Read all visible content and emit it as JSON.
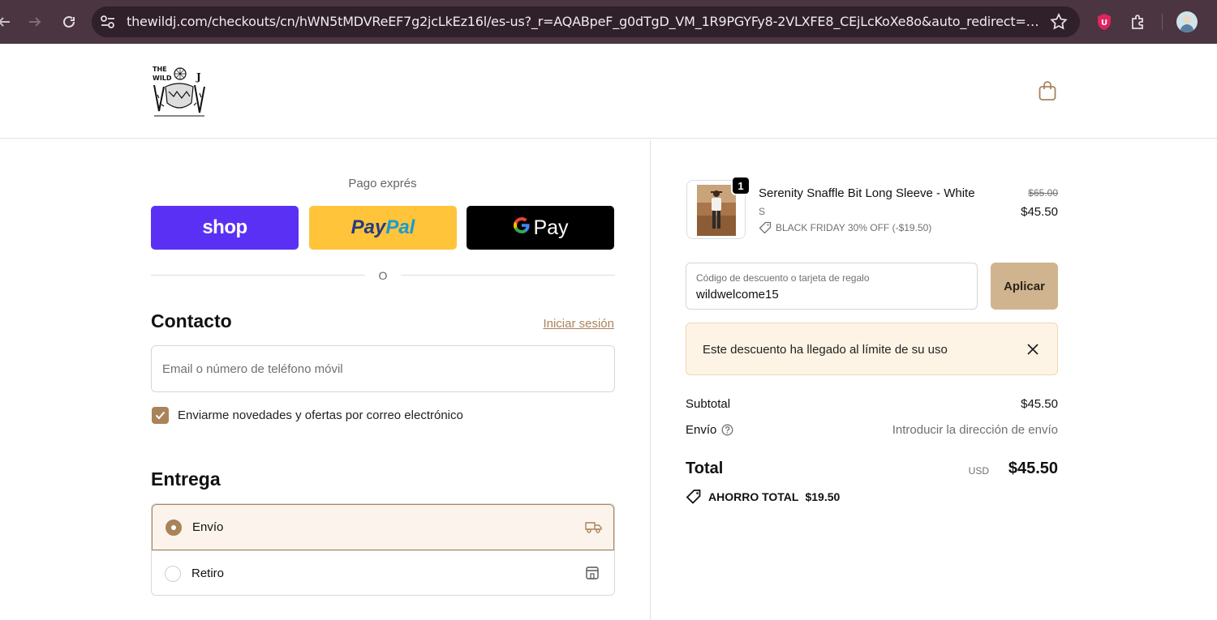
{
  "browser": {
    "url": "thewildj.com/checkouts/cn/hWN5tMDVReEF7g2jcLkEz16l/es-us?_r=AQABpeF_g0dTgD_VM_1R9PGYFy8-2VLXFE8_CEjLcKoXe8o&auto_redirect=false&skip_shop..."
  },
  "header": {
    "logo_text": "THE WILD J"
  },
  "express": {
    "title": "Pago exprés",
    "shop_label": "shop",
    "paypal_part1": "Pay",
    "paypal_part2": "Pal",
    "gpay_label": "Pay",
    "or_text": "O"
  },
  "contact": {
    "heading": "Contacto",
    "login_link": "Iniciar sesión",
    "email_placeholder": "Email o número de teléfono móvil",
    "newsletter_label": "Enviarme novedades y ofertas por correo electrónico",
    "newsletter_checked": true
  },
  "delivery": {
    "heading": "Entrega",
    "options": [
      {
        "label": "Envío",
        "selected": true
      },
      {
        "label": "Retiro",
        "selected": false
      }
    ]
  },
  "order": {
    "item": {
      "qty": "1",
      "name": "Serenity Snaffle Bit Long Sleeve - White",
      "variant": "S",
      "discount": "BLACK FRIDAY 30% OFF (-$19.50)",
      "price_old": "$65.00",
      "price_new": "$45.50"
    },
    "discount_field": {
      "label": "Código de descuento o tarjeta de regalo",
      "value": "wildwelcome15",
      "apply_label": "Aplicar"
    },
    "alert": "Este descuento ha llegado al límite de su uso",
    "subtotal_label": "Subtotal",
    "subtotal_value": "$45.50",
    "shipping_label": "Envío",
    "shipping_value": "Introducir la dirección de envío",
    "total_label": "Total",
    "total_currency": "USD",
    "total_value": "$45.50",
    "savings_label": "AHORRO TOTAL",
    "savings_value": "$19.50"
  },
  "colors": {
    "accent": "#a9835a",
    "shop_purple": "#5a31f4",
    "paypal_yellow": "#ffc439",
    "apply_bg": "#cfb48f",
    "alert_bg": "#fef4e6",
    "chrome_bg": "#4a3541"
  }
}
